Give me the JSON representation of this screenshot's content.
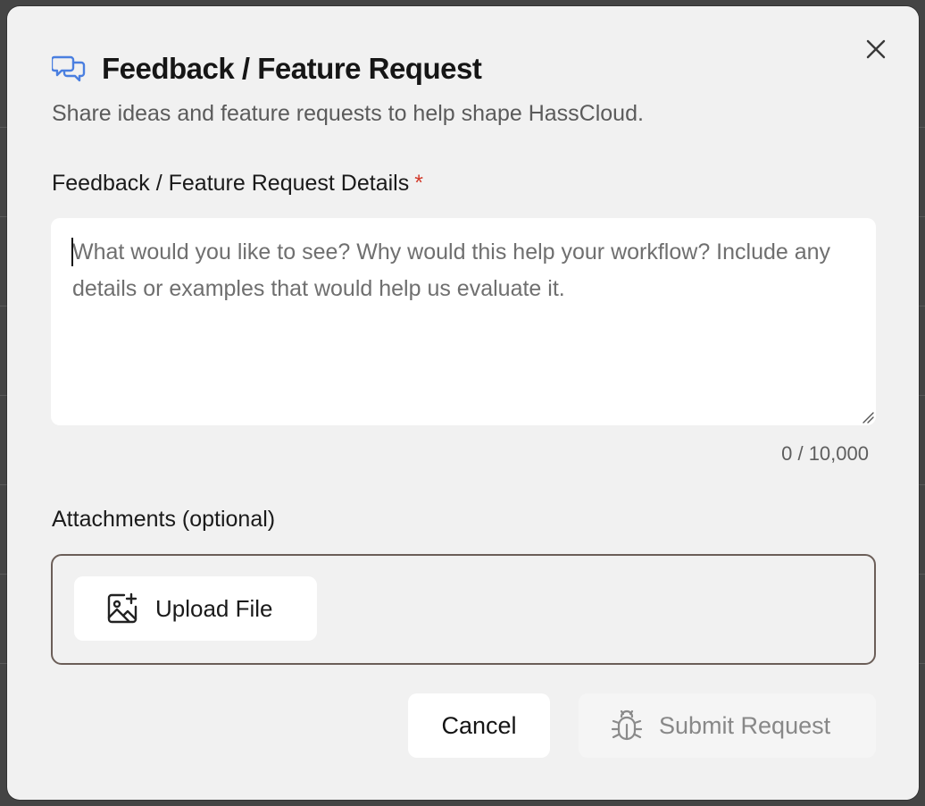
{
  "dialog": {
    "title": "Feedback / Feature Request",
    "subtitle": "Share ideas and feature requests to help shape HassCloud.",
    "title_icon": "chat-bubbles-icon",
    "close_icon": "close-icon"
  },
  "details_field": {
    "label": "Feedback / Feature Request Details",
    "required_marker": "*",
    "value": "",
    "placeholder": "What would you like to see? Why would this help your workflow? Include any details or examples that would help us evaluate it.",
    "counter": "0 / 10,000"
  },
  "attachments": {
    "label": "Attachments (optional)",
    "upload_label": "Upload File",
    "upload_icon": "image-add-icon"
  },
  "actions": {
    "cancel_label": "Cancel",
    "submit_label": "Submit Request",
    "submit_icon": "bug-icon",
    "submit_enabled": false
  },
  "colors": {
    "accent": "#4a7fe0",
    "required": "#d23a2a",
    "dialog_bg": "#f1f1f1",
    "attach_border": "#6b5e58"
  }
}
